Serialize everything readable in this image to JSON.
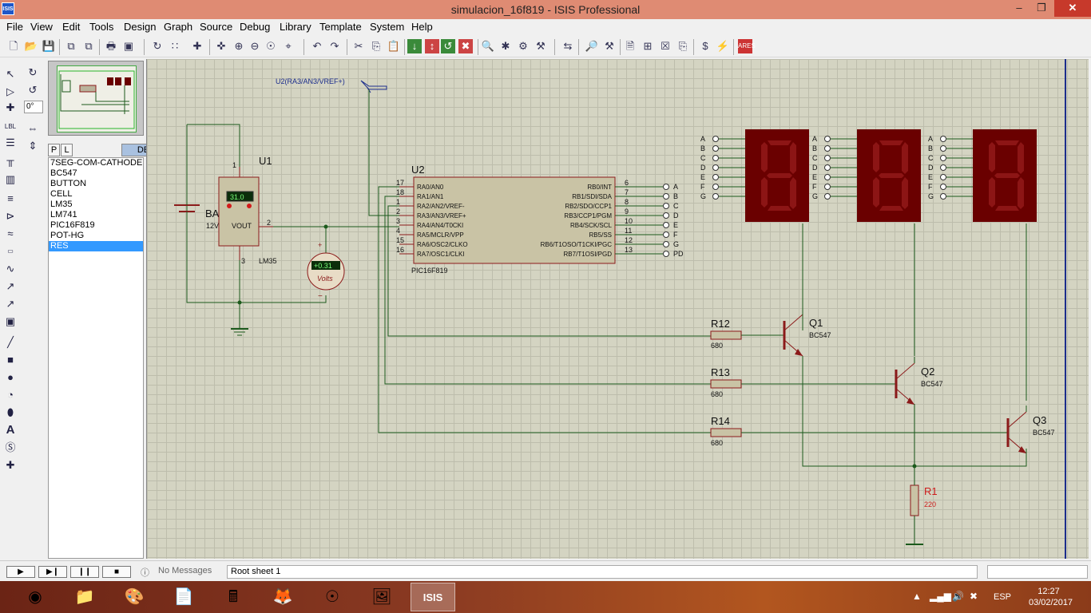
{
  "window": {
    "title": "simulacion_16f819 - ISIS Professional",
    "app_icon": "ISIS"
  },
  "menu": [
    "File",
    "View",
    "Edit",
    "Tools",
    "Design",
    "Graph",
    "Source",
    "Debug",
    "Library",
    "Template",
    "System",
    "Help"
  ],
  "device_panel": {
    "tab_p": "P",
    "tab_l": "L",
    "header": "DEVICES",
    "items": [
      "7SEG-COM-CATHODE",
      "BC547",
      "BUTTON",
      "CELL",
      "LM35",
      "LM741",
      "PIC16F819",
      "POT-HG",
      "RES"
    ],
    "selected": "RES"
  },
  "rotation": "0°",
  "status": {
    "messages": "No Messages",
    "sheet": "Root sheet 1"
  },
  "taskbar": {
    "time": "12:27",
    "date": "03/02/2017",
    "lang": "ESP"
  },
  "schematic": {
    "probe_label": "U2(RA3/AN3/VREF+)",
    "battery": {
      "ref": "BA",
      "value": "12V"
    },
    "u1": {
      "ref": "U1",
      "part": "LM35",
      "display": "31.0",
      "pin_vout": "VOUT",
      "pin1": "1",
      "pin2": "2",
      "pin3": "3"
    },
    "voltmeter": {
      "display": "+0.31",
      "unit": "Volts"
    },
    "u2": {
      "ref": "U2",
      "part": "PIC16F819",
      "left_pins": [
        [
          "17",
          "RA0/AN0"
        ],
        [
          "18",
          "RA1/AN1"
        ],
        [
          "1",
          "RA2/AN2/VREF-"
        ],
        [
          "2",
          "RA3/AN3/VREF+"
        ],
        [
          "3",
          "RA4/AN4/T0CKI"
        ],
        [
          "4",
          "RA5/MCLR/VPP"
        ],
        [
          "15",
          "RA6/OSC2/CLKO"
        ],
        [
          "16",
          "RA7/OSC1/CLKI"
        ]
      ],
      "right_pins": [
        [
          "6",
          "RB0/INT"
        ],
        [
          "7",
          "RB1/SDI/SDA"
        ],
        [
          "8",
          "RB2/SDO/CCP1"
        ],
        [
          "9",
          "RB3/CCP1/PGM"
        ],
        [
          "10",
          "RB4/SCK/SCL"
        ],
        [
          "11",
          "RB5/SS"
        ],
        [
          "12",
          "RB6/T1OSO/T1CKI/PGC"
        ],
        [
          "13",
          "RB7/T1OSI/PGD"
        ]
      ]
    },
    "bus_labels": [
      "A",
      "B",
      "C",
      "D",
      "E",
      "F",
      "G",
      "PD"
    ],
    "seg_labels": [
      "A",
      "B",
      "C",
      "D",
      "E",
      "F",
      "G"
    ],
    "resistors": [
      {
        "ref": "R12",
        "value": "680"
      },
      {
        "ref": "R13",
        "value": "680"
      },
      {
        "ref": "R14",
        "value": "680"
      },
      {
        "ref": "R1",
        "value": "220"
      }
    ],
    "transistors": [
      {
        "ref": "Q1",
        "part": "BC547"
      },
      {
        "ref": "Q2",
        "part": "BC547"
      },
      {
        "ref": "Q3",
        "part": "BC547"
      }
    ],
    "colors": {
      "wire": "#1c5a1c",
      "component": "#8b1a1a",
      "body": "#c9c3a5",
      "display_bg": "#6a0000",
      "segment": "#8c1515",
      "red_text": "#cc1b1b",
      "label_blue": "#1b2d8c"
    }
  }
}
